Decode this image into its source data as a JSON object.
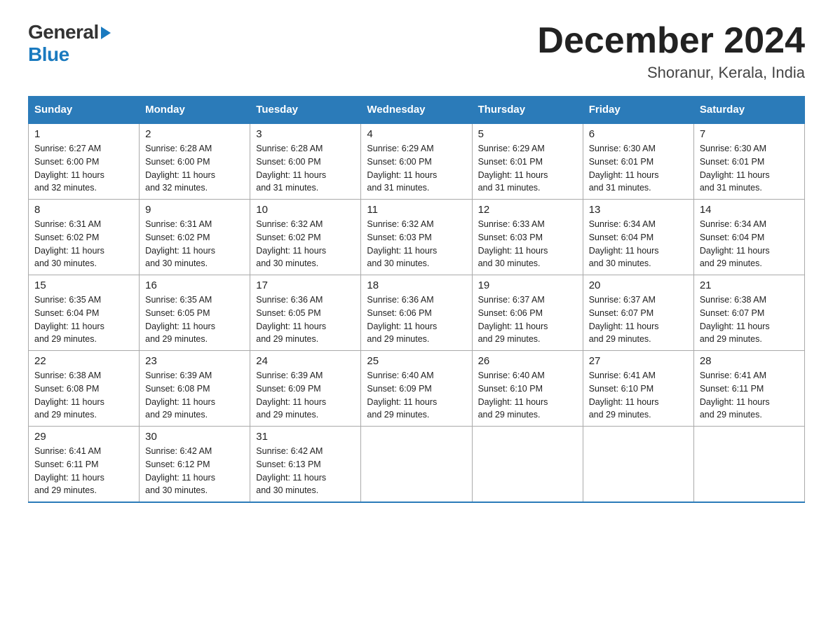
{
  "header": {
    "logo_general": "General",
    "logo_blue": "Blue",
    "month_title": "December 2024",
    "location": "Shoranur, Kerala, India"
  },
  "days_of_week": [
    "Sunday",
    "Monday",
    "Tuesday",
    "Wednesday",
    "Thursday",
    "Friday",
    "Saturday"
  ],
  "weeks": [
    [
      {
        "day": "1",
        "sunrise": "6:27 AM",
        "sunset": "6:00 PM",
        "daylight": "11 hours and 32 minutes."
      },
      {
        "day": "2",
        "sunrise": "6:28 AM",
        "sunset": "6:00 PM",
        "daylight": "11 hours and 32 minutes."
      },
      {
        "day": "3",
        "sunrise": "6:28 AM",
        "sunset": "6:00 PM",
        "daylight": "11 hours and 31 minutes."
      },
      {
        "day": "4",
        "sunrise": "6:29 AM",
        "sunset": "6:00 PM",
        "daylight": "11 hours and 31 minutes."
      },
      {
        "day": "5",
        "sunrise": "6:29 AM",
        "sunset": "6:01 PM",
        "daylight": "11 hours and 31 minutes."
      },
      {
        "day": "6",
        "sunrise": "6:30 AM",
        "sunset": "6:01 PM",
        "daylight": "11 hours and 31 minutes."
      },
      {
        "day": "7",
        "sunrise": "6:30 AM",
        "sunset": "6:01 PM",
        "daylight": "11 hours and 31 minutes."
      }
    ],
    [
      {
        "day": "8",
        "sunrise": "6:31 AM",
        "sunset": "6:02 PM",
        "daylight": "11 hours and 30 minutes."
      },
      {
        "day": "9",
        "sunrise": "6:31 AM",
        "sunset": "6:02 PM",
        "daylight": "11 hours and 30 minutes."
      },
      {
        "day": "10",
        "sunrise": "6:32 AM",
        "sunset": "6:02 PM",
        "daylight": "11 hours and 30 minutes."
      },
      {
        "day": "11",
        "sunrise": "6:32 AM",
        "sunset": "6:03 PM",
        "daylight": "11 hours and 30 minutes."
      },
      {
        "day": "12",
        "sunrise": "6:33 AM",
        "sunset": "6:03 PM",
        "daylight": "11 hours and 30 minutes."
      },
      {
        "day": "13",
        "sunrise": "6:34 AM",
        "sunset": "6:04 PM",
        "daylight": "11 hours and 30 minutes."
      },
      {
        "day": "14",
        "sunrise": "6:34 AM",
        "sunset": "6:04 PM",
        "daylight": "11 hours and 29 minutes."
      }
    ],
    [
      {
        "day": "15",
        "sunrise": "6:35 AM",
        "sunset": "6:04 PM",
        "daylight": "11 hours and 29 minutes."
      },
      {
        "day": "16",
        "sunrise": "6:35 AM",
        "sunset": "6:05 PM",
        "daylight": "11 hours and 29 minutes."
      },
      {
        "day": "17",
        "sunrise": "6:36 AM",
        "sunset": "6:05 PM",
        "daylight": "11 hours and 29 minutes."
      },
      {
        "day": "18",
        "sunrise": "6:36 AM",
        "sunset": "6:06 PM",
        "daylight": "11 hours and 29 minutes."
      },
      {
        "day": "19",
        "sunrise": "6:37 AM",
        "sunset": "6:06 PM",
        "daylight": "11 hours and 29 minutes."
      },
      {
        "day": "20",
        "sunrise": "6:37 AM",
        "sunset": "6:07 PM",
        "daylight": "11 hours and 29 minutes."
      },
      {
        "day": "21",
        "sunrise": "6:38 AM",
        "sunset": "6:07 PM",
        "daylight": "11 hours and 29 minutes."
      }
    ],
    [
      {
        "day": "22",
        "sunrise": "6:38 AM",
        "sunset": "6:08 PM",
        "daylight": "11 hours and 29 minutes."
      },
      {
        "day": "23",
        "sunrise": "6:39 AM",
        "sunset": "6:08 PM",
        "daylight": "11 hours and 29 minutes."
      },
      {
        "day": "24",
        "sunrise": "6:39 AM",
        "sunset": "6:09 PM",
        "daylight": "11 hours and 29 minutes."
      },
      {
        "day": "25",
        "sunrise": "6:40 AM",
        "sunset": "6:09 PM",
        "daylight": "11 hours and 29 minutes."
      },
      {
        "day": "26",
        "sunrise": "6:40 AM",
        "sunset": "6:10 PM",
        "daylight": "11 hours and 29 minutes."
      },
      {
        "day": "27",
        "sunrise": "6:41 AM",
        "sunset": "6:10 PM",
        "daylight": "11 hours and 29 minutes."
      },
      {
        "day": "28",
        "sunrise": "6:41 AM",
        "sunset": "6:11 PM",
        "daylight": "11 hours and 29 minutes."
      }
    ],
    [
      {
        "day": "29",
        "sunrise": "6:41 AM",
        "sunset": "6:11 PM",
        "daylight": "11 hours and 29 minutes."
      },
      {
        "day": "30",
        "sunrise": "6:42 AM",
        "sunset": "6:12 PM",
        "daylight": "11 hours and 30 minutes."
      },
      {
        "day": "31",
        "sunrise": "6:42 AM",
        "sunset": "6:13 PM",
        "daylight": "11 hours and 30 minutes."
      },
      null,
      null,
      null,
      null
    ]
  ],
  "labels": {
    "sunrise": "Sunrise:",
    "sunset": "Sunset:",
    "daylight": "Daylight:"
  }
}
